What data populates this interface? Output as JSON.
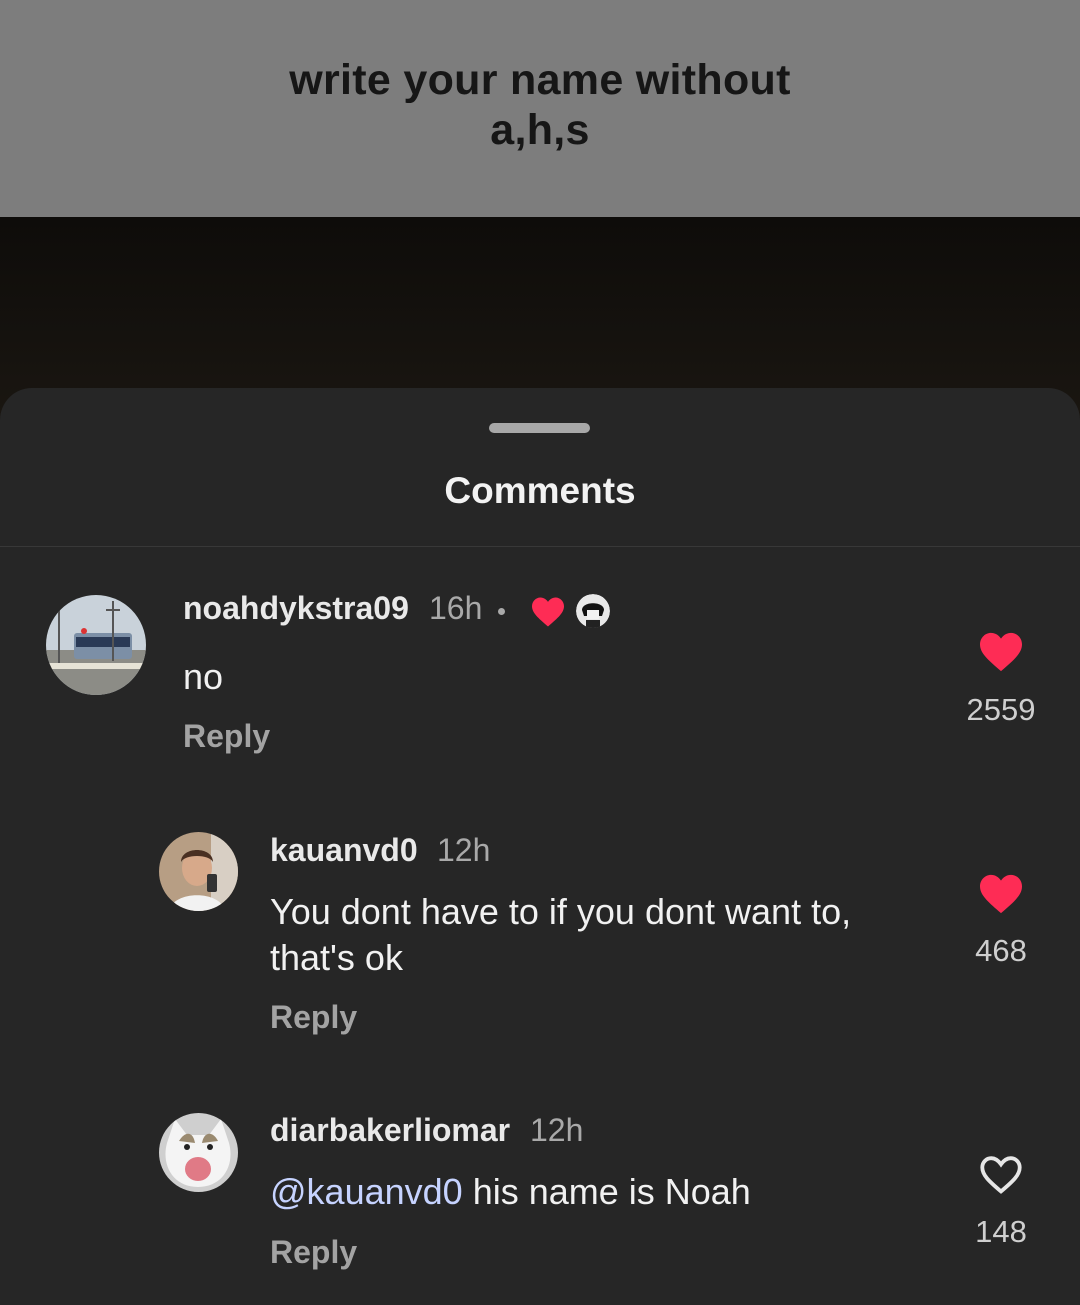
{
  "video": {
    "caption_line1": "write your name without",
    "caption_line2": "a,h,s"
  },
  "sheet": {
    "title": "Comments"
  },
  "comments": [
    {
      "username": "noahdykstra09",
      "time": "16h",
      "creator_liked": true,
      "text": "no",
      "reply_label": "Reply",
      "likes": "2559",
      "liked": true
    },
    {
      "username": "kauanvd0",
      "time": "12h",
      "text_line1": "You dont have to if you dont want to,",
      "text_line2": "that's ok",
      "reply_label": "Reply",
      "likes": "468",
      "liked": true
    },
    {
      "username": "diarbakerliomar",
      "time": "12h",
      "mention": "@kauanvd0",
      "text": " his name is Noah",
      "reply_label": "Reply",
      "likes": "148",
      "liked": false
    }
  ],
  "colors": {
    "heart": "#fe2c55",
    "sheet_bg": "#262626",
    "banner_bg": "#7d7d7d"
  }
}
